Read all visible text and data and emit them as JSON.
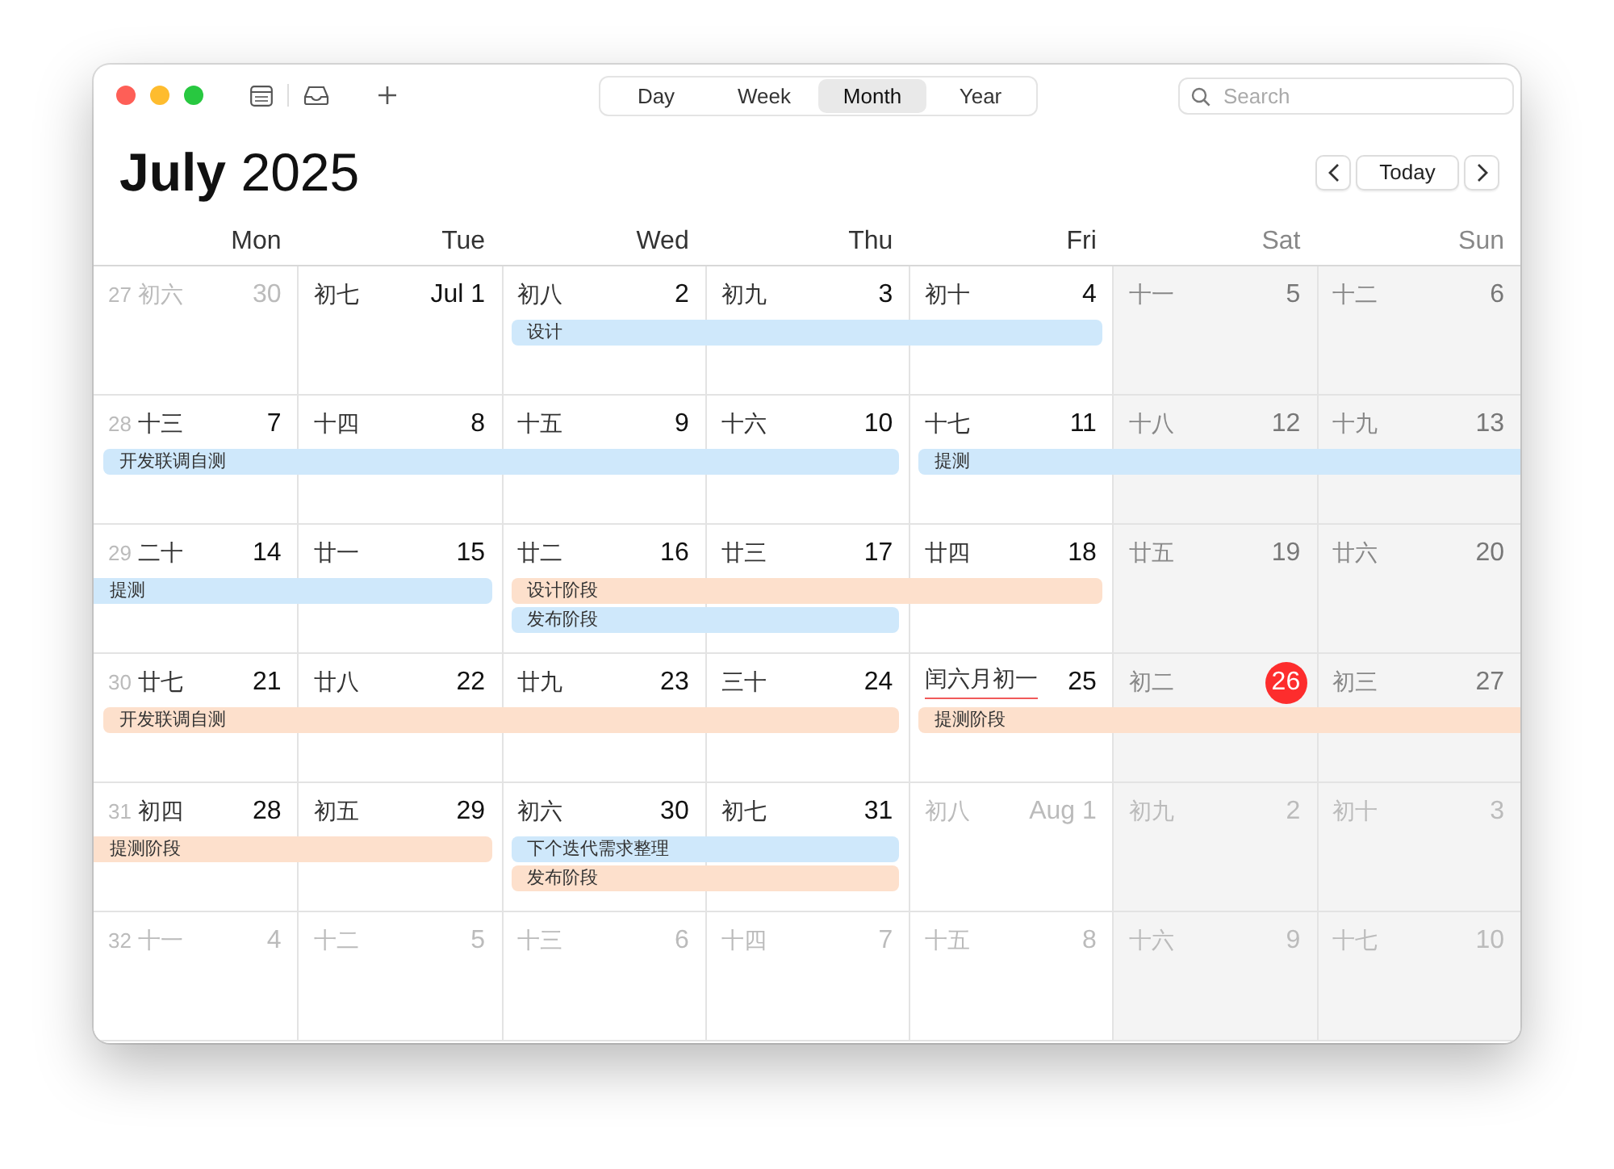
{
  "toolbar": {
    "views": [
      {
        "label": "Day",
        "selected": false
      },
      {
        "label": "Week",
        "selected": false
      },
      {
        "label": "Month",
        "selected": true
      },
      {
        "label": "Year",
        "selected": false
      }
    ],
    "search": {
      "placeholder": "Search"
    }
  },
  "header": {
    "title": "**July** 2025",
    "today_button": "Today"
  },
  "weekdays": [
    {
      "label": "Mon",
      "weekend": false
    },
    {
      "label": "Tue",
      "weekend": false
    },
    {
      "label": "Wed",
      "weekend": false
    },
    {
      "label": "Thu",
      "weekend": false
    },
    {
      "label": "Fri",
      "weekend": false
    },
    {
      "label": "Sat",
      "weekend": true
    },
    {
      "label": "Sun",
      "weekend": true
    }
  ],
  "weeks": [
    {
      "week": "27",
      "days": [
        {
          "lunar": "初六",
          "date": "30",
          "in_month": false,
          "today": false,
          "marked": false
        },
        {
          "lunar": "初七",
          "date": "Jul 1",
          "in_month": true,
          "today": false,
          "marked": false
        },
        {
          "lunar": "初八",
          "date": "2",
          "in_month": true,
          "today": false,
          "marked": false
        },
        {
          "lunar": "初九",
          "date": "3",
          "in_month": true,
          "today": false,
          "marked": false
        },
        {
          "lunar": "初十",
          "date": "4",
          "in_month": true,
          "today": false,
          "marked": false
        },
        {
          "lunar": "十一",
          "date": "5",
          "in_month": true,
          "today": false,
          "marked": false
        },
        {
          "lunar": "十二",
          "date": "6",
          "in_month": true,
          "today": false,
          "marked": false
        }
      ],
      "lanes": [
        [
          {
            "kind": "free"
          },
          {
            "kind": "free"
          },
          {
            "kind": "start",
            "title": "设计",
            "color": "#cfe8fb",
            "continues_before": false,
            "continues_after": false
          },
          {
            "kind": "more"
          },
          {
            "kind": "more"
          },
          {
            "kind": "free"
          },
          {
            "kind": "free"
          }
        ]
      ]
    },
    {
      "week": "28",
      "days": [
        {
          "lunar": "十三",
          "date": "7",
          "in_month": true,
          "today": false,
          "marked": false
        },
        {
          "lunar": "十四",
          "date": "8",
          "in_month": true,
          "today": false,
          "marked": false
        },
        {
          "lunar": "十五",
          "date": "9",
          "in_month": true,
          "today": false,
          "marked": false
        },
        {
          "lunar": "十六",
          "date": "10",
          "in_month": true,
          "today": false,
          "marked": false
        },
        {
          "lunar": "十七",
          "date": "11",
          "in_month": true,
          "today": false,
          "marked": false
        },
        {
          "lunar": "十八",
          "date": "12",
          "in_month": true,
          "today": false,
          "marked": false
        },
        {
          "lunar": "十九",
          "date": "13",
          "in_month": true,
          "today": false,
          "marked": false
        }
      ],
      "lanes": [
        [
          {
            "kind": "start",
            "title": "开发联调自测",
            "color": "#cfe8fb",
            "continues_before": false,
            "continues_after": false
          },
          {
            "kind": "more"
          },
          {
            "kind": "more"
          },
          {
            "kind": "more"
          },
          {
            "kind": "start",
            "title": "提测",
            "color": "#cfe8fb",
            "continues_before": false,
            "continues_after": true
          },
          {
            "kind": "more"
          },
          {
            "kind": "more"
          }
        ]
      ]
    },
    {
      "week": "29",
      "days": [
        {
          "lunar": "二十",
          "date": "14",
          "in_month": true,
          "today": false,
          "marked": false
        },
        {
          "lunar": "廿一",
          "date": "15",
          "in_month": true,
          "today": false,
          "marked": false
        },
        {
          "lunar": "廿二",
          "date": "16",
          "in_month": true,
          "today": false,
          "marked": false
        },
        {
          "lunar": "廿三",
          "date": "17",
          "in_month": true,
          "today": false,
          "marked": false
        },
        {
          "lunar": "廿四",
          "date": "18",
          "in_month": true,
          "today": false,
          "marked": false
        },
        {
          "lunar": "廿五",
          "date": "19",
          "in_month": true,
          "today": false,
          "marked": false
        },
        {
          "lunar": "廿六",
          "date": "20",
          "in_month": true,
          "today": false,
          "marked": false
        }
      ],
      "lanes": [
        [
          {
            "kind": "start",
            "title": "提测",
            "color": "#cfe8fb",
            "continues_before": true,
            "continues_after": false
          },
          {
            "kind": "more"
          },
          {
            "kind": "start",
            "title": "设计阶段",
            "color": "#fde0cc",
            "continues_before": false,
            "continues_after": false
          },
          {
            "kind": "more"
          },
          {
            "kind": "more"
          },
          {
            "kind": "free"
          },
          {
            "kind": "free"
          }
        ],
        [
          {
            "kind": "free"
          },
          {
            "kind": "free"
          },
          {
            "kind": "start",
            "title": "发布阶段",
            "color": "#cfe8fb",
            "continues_before": false,
            "continues_after": false
          },
          {
            "kind": "more"
          },
          {
            "kind": "free"
          },
          {
            "kind": "free"
          },
          {
            "kind": "free"
          }
        ]
      ]
    },
    {
      "week": "30",
      "days": [
        {
          "lunar": "廿七",
          "date": "21",
          "in_month": true,
          "today": false,
          "marked": false
        },
        {
          "lunar": "廿八",
          "date": "22",
          "in_month": true,
          "today": false,
          "marked": false
        },
        {
          "lunar": "廿九",
          "date": "23",
          "in_month": true,
          "today": false,
          "marked": false
        },
        {
          "lunar": "三十",
          "date": "24",
          "in_month": true,
          "today": false,
          "marked": false
        },
        {
          "lunar": "闰六月初一",
          "date": "25",
          "in_month": true,
          "today": false,
          "marked": true
        },
        {
          "lunar": "初二",
          "date": "26",
          "in_month": true,
          "today": true,
          "marked": false
        },
        {
          "lunar": "初三",
          "date": "27",
          "in_month": true,
          "today": false,
          "marked": false
        }
      ],
      "lanes": [
        [
          {
            "kind": "start",
            "title": "开发联调自测",
            "color": "#fde0cc",
            "continues_before": false,
            "continues_after": false
          },
          {
            "kind": "more"
          },
          {
            "kind": "more"
          },
          {
            "kind": "more"
          },
          {
            "kind": "start",
            "title": "提测阶段",
            "color": "#fde0cc",
            "continues_before": false,
            "continues_after": true
          },
          {
            "kind": "more"
          },
          {
            "kind": "more"
          }
        ]
      ]
    },
    {
      "week": "31",
      "days": [
        {
          "lunar": "初四",
          "date": "28",
          "in_month": true,
          "today": false,
          "marked": false
        },
        {
          "lunar": "初五",
          "date": "29",
          "in_month": true,
          "today": false,
          "marked": false
        },
        {
          "lunar": "初六",
          "date": "30",
          "in_month": true,
          "today": false,
          "marked": false
        },
        {
          "lunar": "初七",
          "date": "31",
          "in_month": true,
          "today": false,
          "marked": false
        },
        {
          "lunar": "初八",
          "date": "Aug 1",
          "in_month": false,
          "today": false,
          "marked": false
        },
        {
          "lunar": "初九",
          "date": "2",
          "in_month": false,
          "today": false,
          "marked": false
        },
        {
          "lunar": "初十",
          "date": "3",
          "in_month": false,
          "today": false,
          "marked": false
        }
      ],
      "lanes": [
        [
          {
            "kind": "start",
            "title": "提测阶段",
            "color": "#fde0cc",
            "continues_before": true,
            "continues_after": false
          },
          {
            "kind": "more"
          },
          {
            "kind": "start",
            "title": "下个迭代需求整理",
            "color": "#cfe8fb",
            "continues_before": false,
            "continues_after": false
          },
          {
            "kind": "more"
          },
          {
            "kind": "free"
          },
          {
            "kind": "free"
          },
          {
            "kind": "free"
          }
        ],
        [
          {
            "kind": "free"
          },
          {
            "kind": "free"
          },
          {
            "kind": "start",
            "title": "发布阶段",
            "color": "#fde0cc",
            "continues_before": false,
            "continues_after": false
          },
          {
            "kind": "more"
          },
          {
            "kind": "free"
          },
          {
            "kind": "free"
          },
          {
            "kind": "free"
          }
        ]
      ]
    },
    {
      "week": "32",
      "days": [
        {
          "lunar": "十一",
          "date": "4",
          "in_month": false,
          "today": false,
          "marked": false
        },
        {
          "lunar": "十二",
          "date": "5",
          "in_month": false,
          "today": false,
          "marked": false
        },
        {
          "lunar": "十三",
          "date": "6",
          "in_month": false,
          "today": false,
          "marked": false
        },
        {
          "lunar": "十四",
          "date": "7",
          "in_month": false,
          "today": false,
          "marked": false
        },
        {
          "lunar": "十五",
          "date": "8",
          "in_month": false,
          "today": false,
          "marked": false
        },
        {
          "lunar": "十六",
          "date": "9",
          "in_month": false,
          "today": false,
          "marked": false
        },
        {
          "lunar": "十七",
          "date": "10",
          "in_month": false,
          "today": false,
          "marked": false
        }
      ]
    }
  ]
}
